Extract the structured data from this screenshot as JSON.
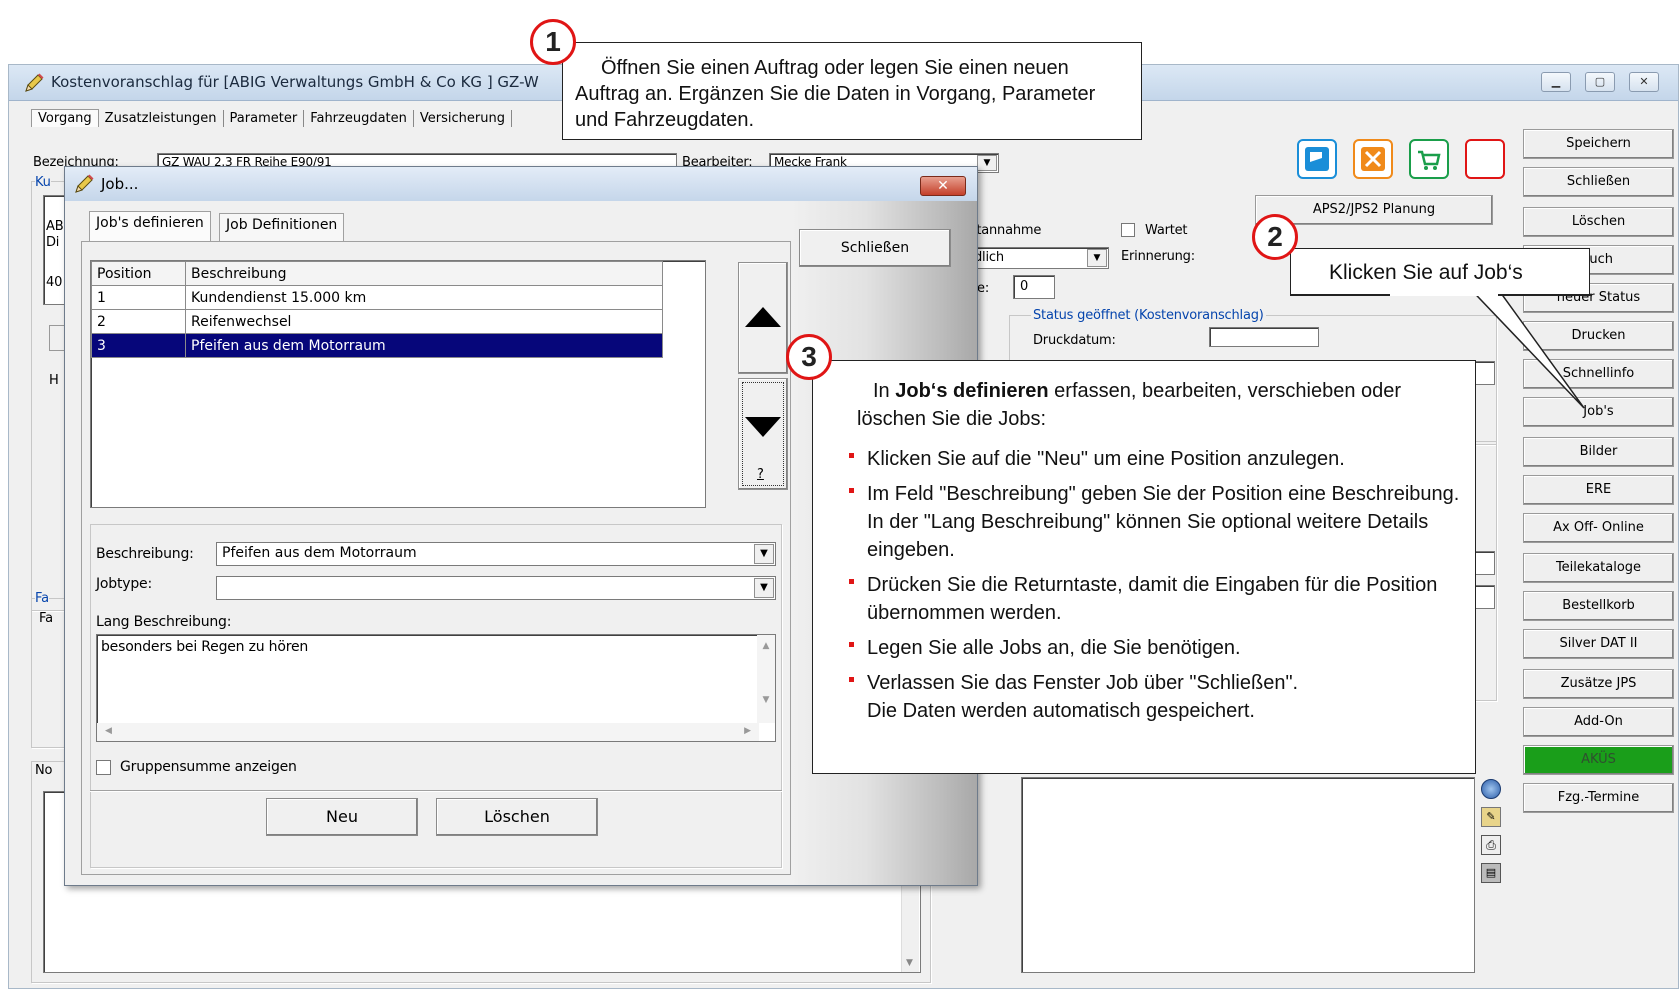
{
  "main_window": {
    "title": "Kostenvoranschlag für [ABIG Verwaltungs GmbH & Co KG ] GZ-W",
    "tabs": [
      "Vorgang",
      "Zusatzleistungen",
      "Parameter",
      "Fahrzeugdaten",
      "Versicherung"
    ],
    "bezeichnung_label": "Bezeichnung:",
    "bezeichnung_value": "GZ WAU 2.3 FR Reihe E90/91",
    "bearbeiter_label": "Bearbeiter:",
    "bearbeiter_value": "Mecke Frank",
    "partial_labels": {
      "ku": "Ku",
      "ab": "AB",
      "di": "Di",
      "n40": "40",
      "h": "H",
      "fa": "Fa",
      "fa2": "Fa",
      "no": "No"
    },
    "direktannahme_label": "ktannahme",
    "wartet_label": "Wartet",
    "select_value": "dlich",
    "erinnerung_label": "Erinnerung:",
    "tage_label": "ge:",
    "tage_value": "0",
    "planung_button": "APS2/JPS2 Planung",
    "status_group_label": "Status geöffnet (Kostenvoranschlag)",
    "druckdatum_label": "Druckdatum:",
    "right_buttons": [
      "Speichern",
      "Schließen",
      "Löschen",
      "ruch",
      "neuer Status",
      "Drucken",
      "Schnellinfo",
      "Job's",
      "Bilder",
      "ERE",
      "Ax Off- Online",
      "Teilekataloge",
      "Bestellkorb",
      "Silver DAT II",
      "Zusätze JPS",
      "Add-On",
      "AKÜS",
      "Fzg.-Termine"
    ],
    "toolbar_icons": [
      "save-doc-icon",
      "tools-icon",
      "cart-icon",
      "red-frame-icon"
    ],
    "side_icons": [
      "compass-icon",
      "wrench-icon",
      "printer-icon",
      "clipboard-icon"
    ],
    "colors": {
      "akus_green": "#1a9e1a",
      "accent_red": "#e01515",
      "selection_blue": "#06067a"
    }
  },
  "job_dialog": {
    "title": "Job...",
    "tabs": [
      "Job's definieren",
      "Job Definitionen"
    ],
    "close_button": "Schließen",
    "table": {
      "headers": [
        "Position",
        "Beschreibung"
      ],
      "rows": [
        {
          "position": "1",
          "beschreibung": "Kundendienst 15.000 km"
        },
        {
          "position": "2",
          "beschreibung": "Reifenwechsel"
        },
        {
          "position": "3",
          "beschreibung": "Pfeifen aus dem Motorraum",
          "selected": true
        }
      ]
    },
    "question_mark": "?",
    "beschreibung_label": "Beschreibung:",
    "beschreibung_value": "Pfeifen aus dem Motorraum",
    "jobtype_label": "Jobtype:",
    "jobtype_value": "",
    "lang_label": "Lang Beschreibung:",
    "lang_value": "besonders bei Regen zu hören",
    "checkbox_label": "Gruppensumme anzeigen",
    "new_button": "Neu",
    "delete_button": "Löschen"
  },
  "callouts": {
    "c1_number": "1",
    "c1_text": "Öffnen Sie einen Auftrag oder legen Sie einen neuen Auftrag an. Ergänzen Sie die Daten in Vorgang, Parameter und  Fahrzeugdaten.",
    "c2_number": "2",
    "c2_text": "Klicken Sie auf Job‘s",
    "c3_number": "3",
    "c3_intro_pre": "In ",
    "c3_intro_bold": "Job‘s definieren",
    "c3_intro_post": " erfassen, bearbeiten, verschieben oder löschen Sie die Jobs:",
    "c3_items": [
      "Klicken Sie auf die \"Neu\" um eine Position anzulegen.",
      "Im Feld \"Beschreibung\" geben Sie der Position eine Beschreibung.",
      "In der \"Lang Beschreibung\" können Sie optional weitere Details eingeben.",
      "Drücken Sie die Returntaste, damit die Eingaben für die Position übernommen werden.",
      "Legen Sie alle Jobs an, die Sie benötigen.",
      "Verlassen Sie das Fenster Job über \"Schließen\".",
      "Die Daten werden automatisch gespeichert."
    ]
  }
}
